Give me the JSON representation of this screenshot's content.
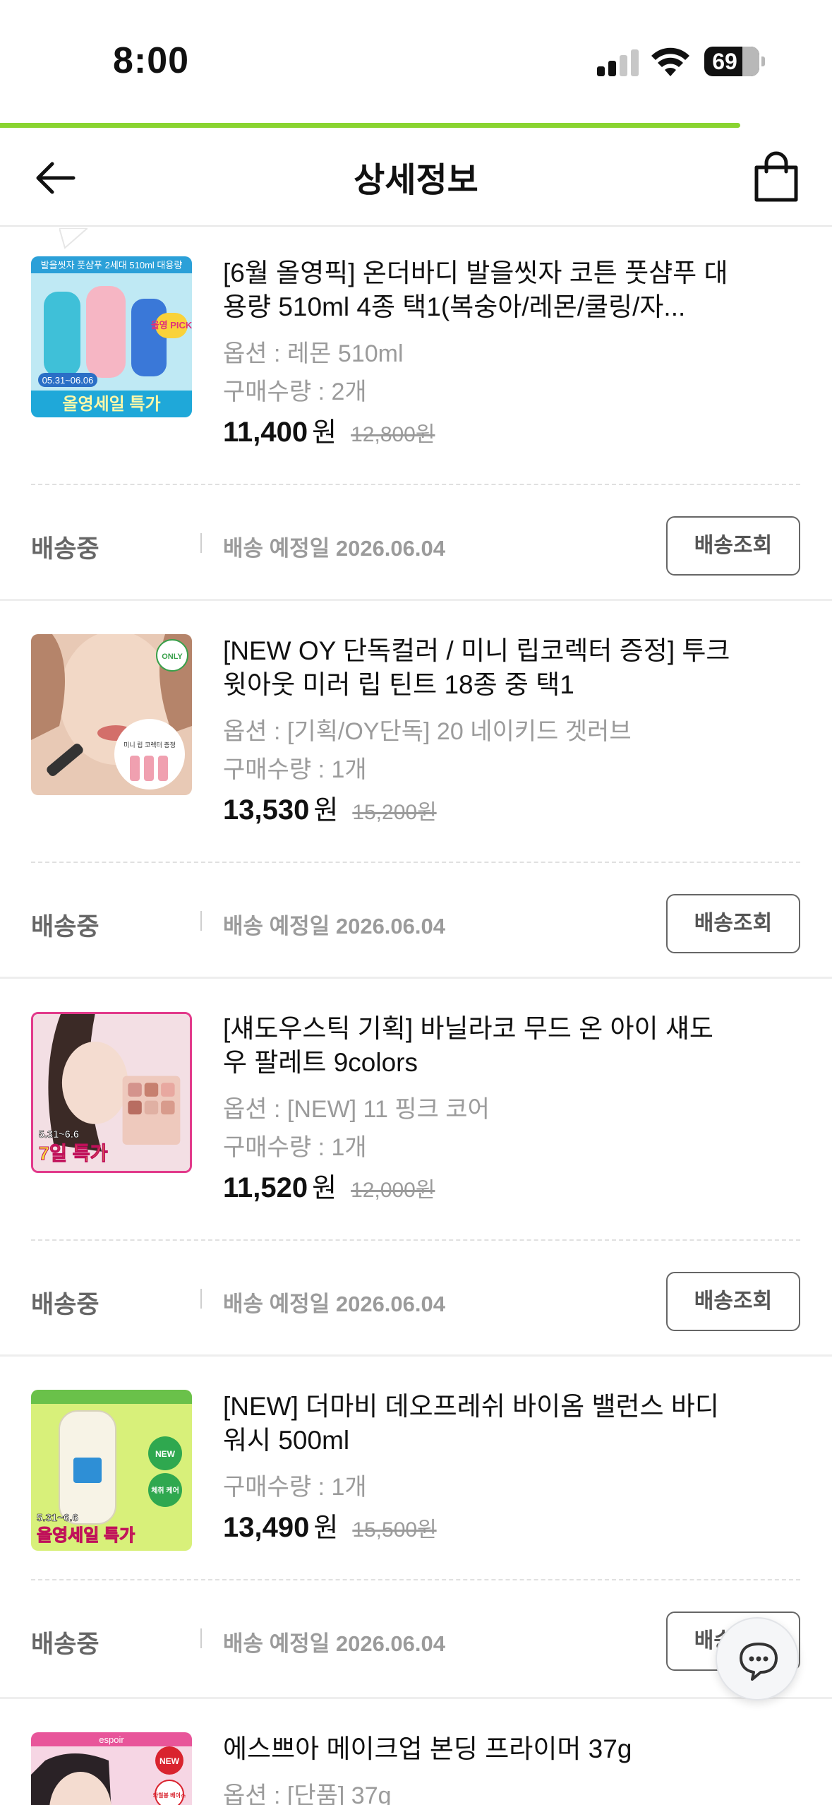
{
  "status_bar": {
    "time": "8:00",
    "battery": "69"
  },
  "header": {
    "title": "상세정보"
  },
  "progress": 0.89,
  "products": [
    {
      "name": "[6월 올영픽] 온더바디 발을씻자 코튼 풋샴푸 대용량 510ml 4종 택1(복숭아/레몬/쿨링/자...",
      "option": "옵션 : 레몬 510ml",
      "quantity": "구매수량 : 2개",
      "price": "11,400",
      "currency": "원",
      "original_price": "12,800원",
      "status": "배송중",
      "ship_label": "배송 예정일",
      "ship_date": "2026.06.04",
      "button": "배송조회",
      "thumb_text": {
        "top": "발을씻자 풋샴푸 2세대 510ml 대용량",
        "badge": "올영 PICK",
        "date": "05.31~06.06",
        "sale": "올영세일 특가"
      },
      "colors": {
        "bg": "#bfe9f4",
        "accent": "#2ba0d8"
      }
    },
    {
      "name": "[NEW OY 단독컬러 / 미니 립코렉터 증정] 투크 윗아웃 미러 립 틴트 18종 중 택1",
      "option": "옵션 : [기획/OY단독] 20 네이키드 겟러브",
      "quantity": "구매수량 : 1개",
      "price": "13,530",
      "currency": "원",
      "original_price": "15,200원",
      "status": "배송중",
      "ship_label": "배송 예정일",
      "ship_date": "2026.06.04",
      "button": "배송조회",
      "thumb_text": {
        "badge": "ONLY",
        "caption": "미니 립 코렉터 증정"
      },
      "colors": {
        "bg": "#e8c9b5",
        "accent": "#c98c74"
      }
    },
    {
      "name": "[섀도우스틱 기획] 바닐라코 무드 온 아이 섀도우 팔레트 9colors",
      "option": "옵션 : [NEW] 11 핑크 코어",
      "quantity": "구매수량 : 1개",
      "price": "11,520",
      "currency": "원",
      "original_price": "12,000원",
      "status": "배송중",
      "ship_label": "배송 예정일",
      "ship_date": "2026.06.04",
      "button": "배송조회",
      "thumb_text": {
        "date": "5.31~6.6",
        "sale": "7일 특가"
      },
      "colors": {
        "bg": "#f3dfe4",
        "accent": "#e23a8b"
      }
    },
    {
      "name": "[NEW] 더마비 데오프레쉬 바이옴 밸런스 바디워시 500ml",
      "option": "",
      "quantity": "구매수량 : 1개",
      "price": "13,490",
      "currency": "원",
      "original_price": "15,500원",
      "status": "배송중",
      "ship_label": "배송 예정일",
      "ship_date": "2026.06.04",
      "button": "배송조회",
      "thumb_text": {
        "badge": "NEW",
        "badge2": "체취 케어",
        "date": "5.31~6.6",
        "sale": "올영세일 특가"
      },
      "colors": {
        "bg": "#d8f07a",
        "accent": "#2fa84f"
      }
    },
    {
      "name": "에스쁘아 메이크업 본딩 프라이머 37g",
      "option": "옵션 : [단품] 37g",
      "quantity": "",
      "price": "",
      "currency": "",
      "original_price": "",
      "thumb_text": {
        "brand": "espoir",
        "badge": "NEW",
        "badge2": "와칠봉 베이스"
      },
      "colors": {
        "bg": "#f6d6e4",
        "accent": "#e0307a"
      }
    }
  ]
}
